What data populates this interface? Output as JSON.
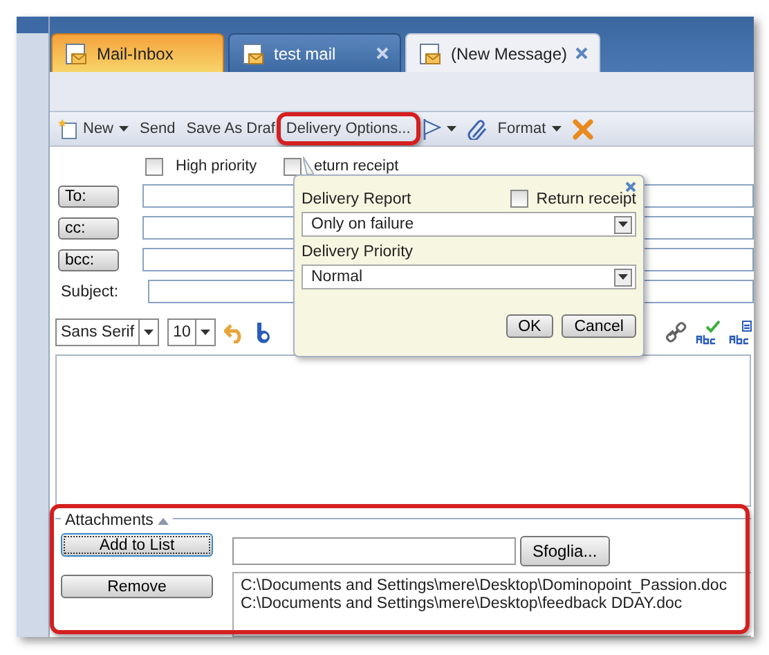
{
  "tabs": [
    {
      "label": "Mail-Inbox",
      "selected": false,
      "kind": "home",
      "closable": false
    },
    {
      "label": "test mail",
      "selected": false,
      "kind": "doc",
      "closable": true
    },
    {
      "label": "(New Message)",
      "selected": true,
      "kind": "doc",
      "closable": true
    }
  ],
  "toolbar": [
    {
      "kind": "new",
      "label": "New",
      "has_menu": true
    },
    {
      "kind": "text",
      "label": "Send",
      "has_menu": false
    },
    {
      "kind": "text",
      "label": "Save As Draf",
      "has_menu": false
    },
    {
      "kind": "text",
      "label": "Delivery Options...",
      "has_menu": false,
      "highlighted": true
    },
    {
      "kind": "flag",
      "has_menu": true
    },
    {
      "kind": "clip",
      "has_menu": false
    },
    {
      "kind": "text",
      "label": "Format",
      "has_menu": true
    },
    {
      "kind": "discard",
      "has_menu": false
    }
  ],
  "options": [
    {
      "label": "High priority",
      "checked": false
    },
    {
      "label": "eturn receipt",
      "checked": false
    }
  ],
  "recipients": [
    {
      "label": "To:"
    },
    {
      "label": "cc:"
    },
    {
      "label": "bcc:"
    }
  ],
  "subject": {
    "label": "Subject:"
  },
  "format_bar": {
    "font": "Sans Serif",
    "size": "10"
  },
  "delivery_popup": {
    "return_receipt": {
      "label": "Return receipt",
      "checked": false
    },
    "report": {
      "label": "Delivery Report",
      "value": "Only on failure"
    },
    "priority": {
      "label": "Delivery Priority",
      "value": "Normal"
    },
    "buttons": [
      "OK",
      "Cancel"
    ]
  },
  "attachments": {
    "legend": "Attachments",
    "highlighted": true,
    "add_button": "Add to List",
    "browse_button": "Sfoglia...",
    "remove_button": "Remove",
    "files": [
      "C:\\Documents and Settings\\mere\\Desktop\\Dominopoint_Passion.doc",
      "C:\\Documents and Settings\\mere\\Desktop\\feedback DDAY.doc"
    ]
  }
}
